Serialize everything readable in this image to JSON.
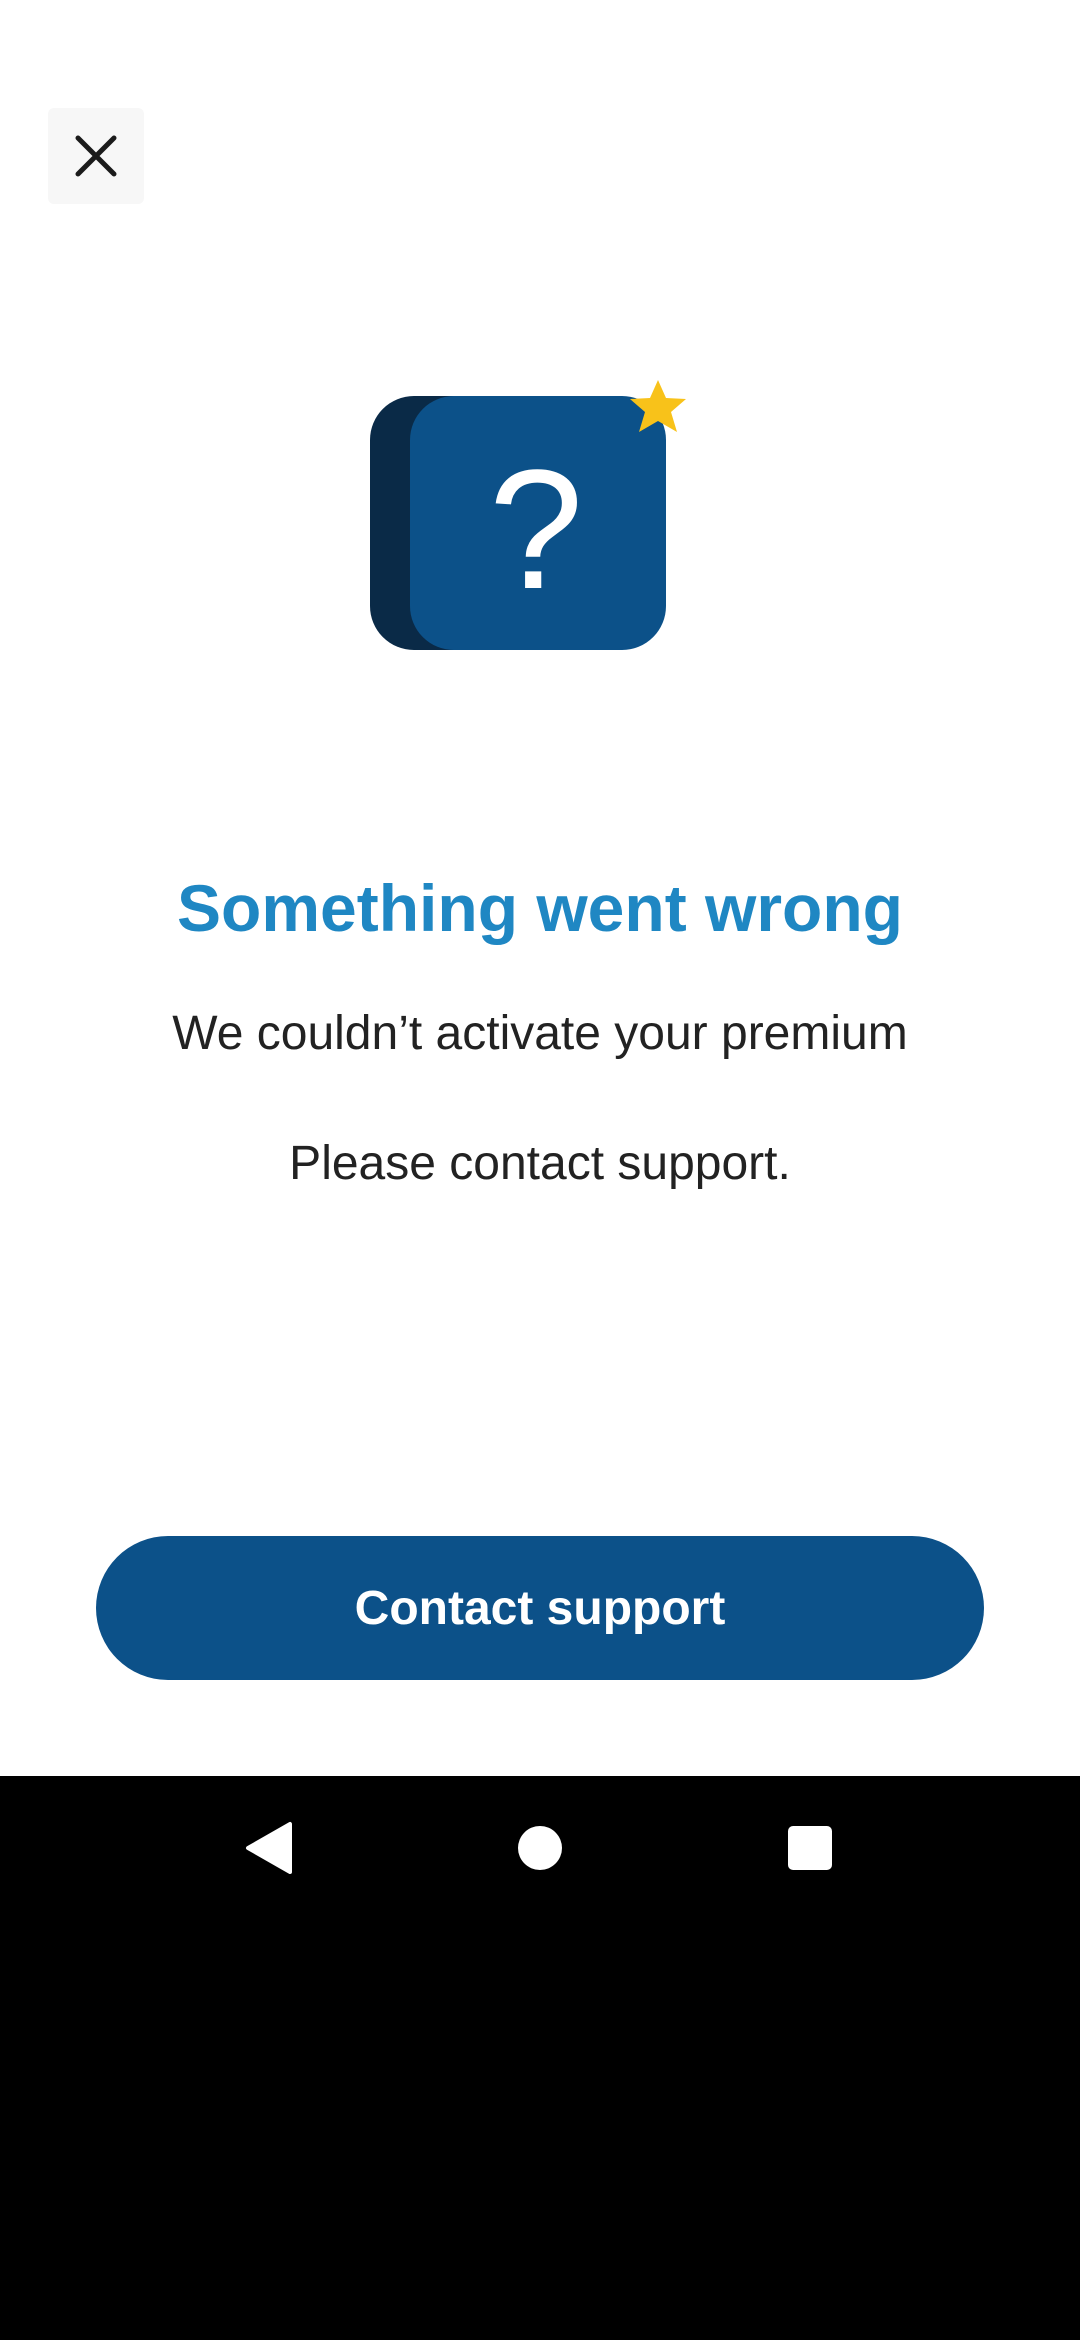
{
  "dialog": {
    "title": "Something went wrong",
    "message_line1": "We couldn’t activate your premium",
    "message_line2": "Please contact support.",
    "cta_label": "Contact support"
  },
  "icons": {
    "close": "close-icon",
    "illustration": "question-mark-box-icon",
    "star": "star-icon",
    "nav_back": "back-triangle-icon",
    "nav_home": "home-circle-icon",
    "nav_recent": "recent-apps-square-icon"
  },
  "colors": {
    "title": "#1f87c3",
    "primary": "#0c5189",
    "illustration_dark": "#0a2a47",
    "star": "#f8c21a",
    "text": "#222222"
  }
}
